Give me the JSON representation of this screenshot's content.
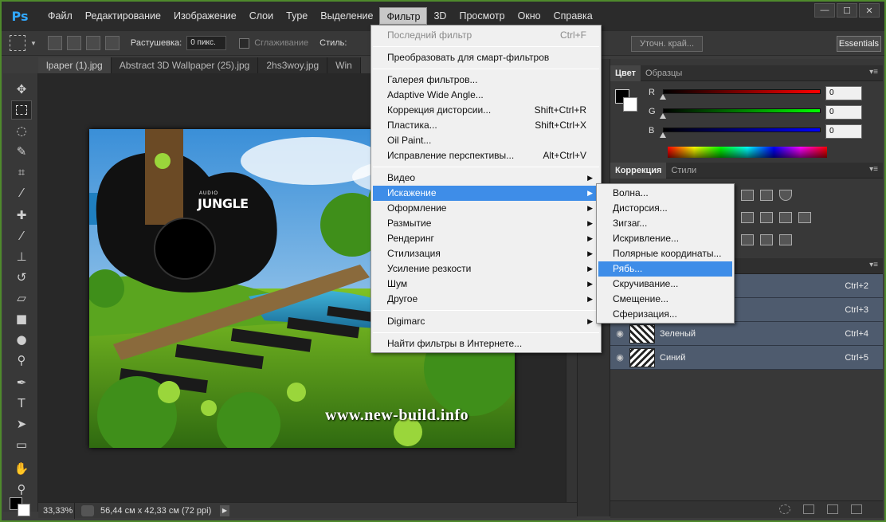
{
  "menubar": {
    "logo": "Ps",
    "items": [
      "Файл",
      "Редактирование",
      "Изображение",
      "Слои",
      "Type",
      "Выделение",
      "Фильтр",
      "3D",
      "Просмотр",
      "Окно",
      "Справка"
    ],
    "active_index": 6
  },
  "window_controls": {
    "minimize": "—",
    "maximize": "☐",
    "close": "✕"
  },
  "options_bar": {
    "feather_label": "Растушевка:",
    "feather_value": "0 пикс.",
    "antialias_label": "Сглаживание",
    "style_label": "Стиль:",
    "refine_edge": "Уточн. край...",
    "workspace": "Essentials"
  },
  "tabs": [
    "lpaper (1).jpg",
    "Abstract 3D Wallpaper (25).jpg",
    "2hs3woy.jpg",
    "Win"
  ],
  "canvas": {
    "watermark": "www.new-build.info",
    "logo_small": "AUDIO",
    "logo_big": "JUNGLE"
  },
  "status_bar": {
    "zoom": "33,33%",
    "doc_info": "56,44 см x 42,33 см (72 ppi)",
    "arrow": "▶"
  },
  "color_panel": {
    "tabs": [
      "Цвет",
      "Образцы"
    ],
    "menu": "▾≡",
    "channels": [
      {
        "label": "R",
        "value": "0",
        "gradient": "#ff0000"
      },
      {
        "label": "G",
        "value": "0",
        "gradient": "#00ff00"
      },
      {
        "label": "B",
        "value": "0",
        "gradient": "#0000ff"
      }
    ]
  },
  "adjustments_panel": {
    "tabs": [
      "Коррекция",
      "Стили"
    ],
    "menu": "▾≡"
  },
  "layers_panel": {
    "menu": "▾≡",
    "rows": [
      {
        "name": "",
        "shortcut": "Ctrl+2"
      },
      {
        "name": "",
        "shortcut": "Ctrl+3"
      },
      {
        "name": "Зеленый",
        "shortcut": "Ctrl+4"
      },
      {
        "name": "Синий",
        "shortcut": "Ctrl+5"
      }
    ]
  },
  "filter_menu": {
    "items": [
      {
        "label": "Последний фильтр",
        "key": "Ctrl+F",
        "disabled": true
      },
      {
        "sep": true
      },
      {
        "label": "Преобразовать для смарт-фильтров",
        "key": ""
      },
      {
        "sep": true
      },
      {
        "label": "Галерея фильтров...",
        "key": ""
      },
      {
        "label": "Adaptive Wide Angle...",
        "key": ""
      },
      {
        "label": "Коррекция дисторсии...",
        "key": "Shift+Ctrl+R"
      },
      {
        "label": "Пластика...",
        "key": "Shift+Ctrl+X"
      },
      {
        "label": "Oil Paint...",
        "key": ""
      },
      {
        "label": "Исправление перспективы...",
        "key": "Alt+Ctrl+V"
      },
      {
        "sep": true
      },
      {
        "label": "Видео",
        "submenu": true
      },
      {
        "label": "Искажение",
        "submenu": true,
        "highlighted": true
      },
      {
        "label": "Оформление",
        "submenu": true
      },
      {
        "label": "Размытие",
        "submenu": true
      },
      {
        "label": "Рендеринг",
        "submenu": true
      },
      {
        "label": "Стилизация",
        "submenu": true
      },
      {
        "label": "Усиление резкости",
        "submenu": true
      },
      {
        "label": "Шум",
        "submenu": true
      },
      {
        "label": "Другое",
        "submenu": true
      },
      {
        "sep": true
      },
      {
        "label": "Digimarc",
        "submenu": true
      },
      {
        "sep": true
      },
      {
        "label": "Найти фильтры в Интернете...",
        "key": ""
      }
    ]
  },
  "distort_submenu": {
    "items": [
      {
        "label": "Волна..."
      },
      {
        "label": "Дисторсия..."
      },
      {
        "label": "Зигзаг..."
      },
      {
        "label": "Искривление..."
      },
      {
        "label": "Полярные координаты..."
      },
      {
        "label": "Рябь...",
        "highlighted": true
      },
      {
        "label": "Скручивание..."
      },
      {
        "label": "Смещение..."
      },
      {
        "label": "Сферизация..."
      }
    ]
  },
  "colors": {
    "highlight": "#3e8de8",
    "frame": "#4f8a2c",
    "layer_row": "#4e5b6e"
  }
}
